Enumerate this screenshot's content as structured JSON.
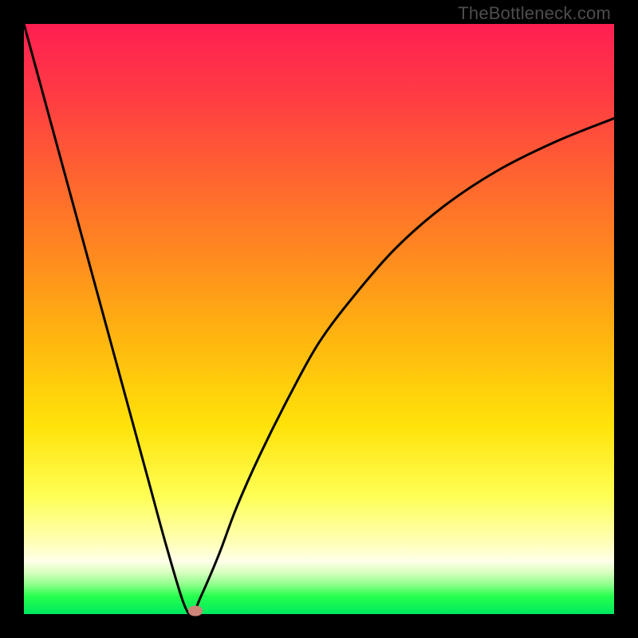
{
  "watermark": {
    "text": "TheBottleneck.com"
  },
  "chart_data": {
    "type": "line",
    "title": "",
    "xlabel": "",
    "ylabel": "",
    "xlim": [
      0,
      100
    ],
    "ylim": [
      0,
      100
    ],
    "grid": false,
    "legend": false,
    "series": [
      {
        "name": "bottleneck-curve",
        "x": [
          0,
          3,
          6,
          9,
          12,
          15,
          18,
          21,
          24,
          27,
          28.5,
          30,
          33,
          36,
          40,
          45,
          50,
          56,
          63,
          71,
          80,
          90,
          100
        ],
        "y": [
          100,
          89,
          78,
          67,
          56,
          45,
          34,
          23,
          12,
          2,
          0,
          3,
          10,
          18,
          27,
          37,
          46,
          54,
          62,
          69,
          75,
          80,
          84
        ]
      }
    ],
    "marker": {
      "x": 29.0,
      "y": 0.5,
      "color": "#cd8579"
    },
    "background_gradient": {
      "direction": "top-to-bottom",
      "stops": [
        {
          "pos": 0.0,
          "color": "#ff1f52"
        },
        {
          "pos": 0.28,
          "color": "#ff6a2d"
        },
        {
          "pos": 0.54,
          "color": "#ffb80f"
        },
        {
          "pos": 0.8,
          "color": "#ffff55"
        },
        {
          "pos": 0.91,
          "color": "#ffffea"
        },
        {
          "pos": 1.0,
          "color": "#00e85e"
        }
      ]
    }
  }
}
